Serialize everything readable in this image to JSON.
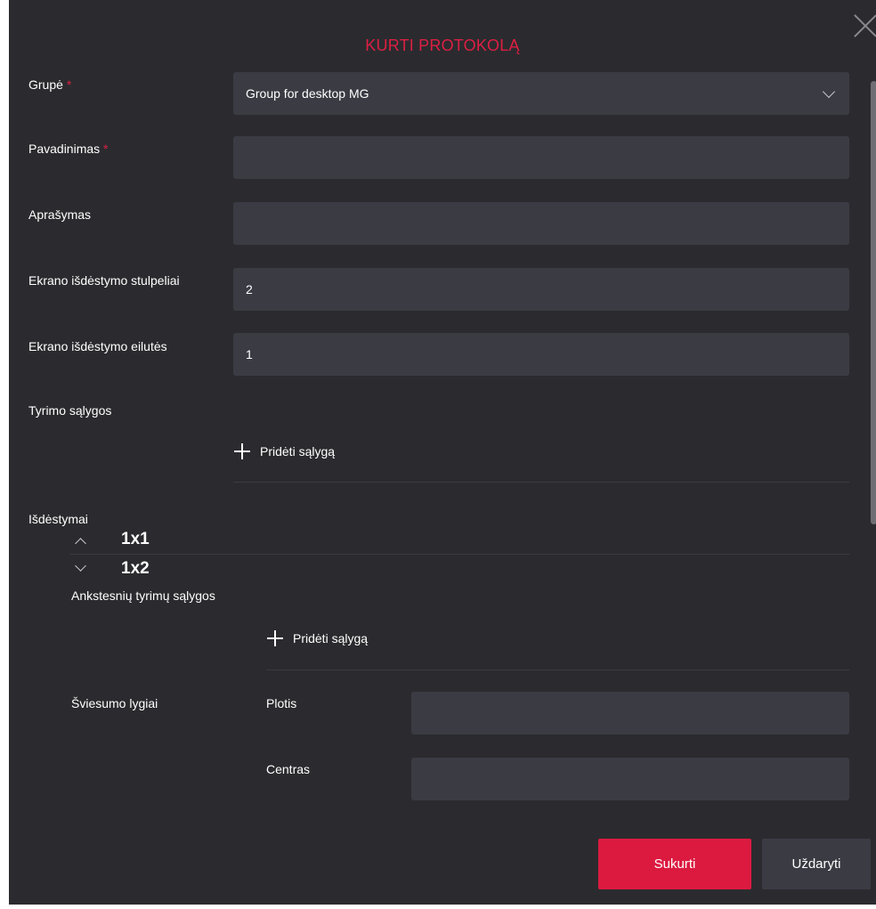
{
  "dialog": {
    "title": "KURTI PROTOKOLĄ",
    "close_icon": "close-icon"
  },
  "form": {
    "group": {
      "label": "Grupė",
      "required_mark": "*",
      "value": "Group for desktop MG"
    },
    "name": {
      "label": "Pavadinimas",
      "required_mark": "*",
      "value": ""
    },
    "description": {
      "label": "Aprašymas",
      "value": ""
    },
    "layout_columns": {
      "label": "Ekrano išdėstymo stulpeliai",
      "value": "2"
    },
    "layout_rows": {
      "label": "Ekrano išdėstymo eilutės",
      "value": "1"
    },
    "study_conditions": {
      "label": "Tyrimo sąlygos",
      "add_label": "Pridėti sąlygą"
    },
    "layouts": {
      "label": "Išdėstymai",
      "items": [
        {
          "title": "1x1",
          "expanded": true
        },
        {
          "title": "1x2",
          "expanded": false
        }
      ],
      "previous_conditions": {
        "label": "Ankstesnių tyrimų sąlygos",
        "add_label": "Pridėti sąlygą"
      },
      "brightness": {
        "label": "Šviesumo lygiai",
        "width_label": "Plotis",
        "width_value": "",
        "center_label": "Centras",
        "center_value": ""
      }
    }
  },
  "footer": {
    "create_label": "Sukurti",
    "close_label": "Uždaryti"
  },
  "colors": {
    "accent": "#dc1f43",
    "background": "#2b2b2f",
    "field": "#3b3b44"
  }
}
